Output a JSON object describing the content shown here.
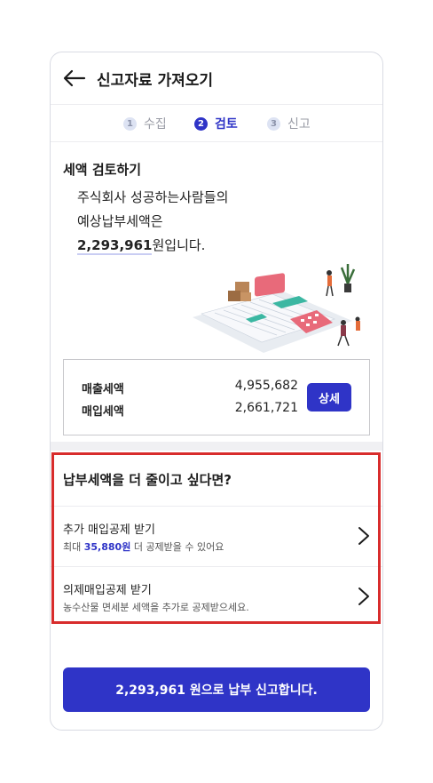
{
  "header": {
    "title": "신고자료 가져오기"
  },
  "steps": [
    {
      "num": "1",
      "label": "수집"
    },
    {
      "num": "2",
      "label": "검토"
    },
    {
      "num": "3",
      "label": "신고"
    }
  ],
  "review": {
    "section_title": "세액 검토하기",
    "line1": "주식회사 성공하는사람들의",
    "line2": "예상납부세액은",
    "amount": "2,293,961",
    "amount_suffix": "원입니다."
  },
  "totals": {
    "sales_label": "매출세액",
    "sales_value": "4,955,682",
    "purchase_label": "매입세액",
    "purchase_value": "2,661,721",
    "detail_button": "상세"
  },
  "reduce": {
    "title": "납부세액을 더 줄이고 싶다면?",
    "options": [
      {
        "title": "추가 매입공제 받기",
        "desc_prefix": "최대 ",
        "desc_amount": "35,880원",
        "desc_suffix": " 더 공제받을 수 있어요"
      },
      {
        "title": "의제매입공제 받기",
        "desc": "농수산물 면세분 세액을 추가로 공제받으세요."
      }
    ]
  },
  "cta": {
    "label": "2,293,961 원으로 납부 신고합니다."
  },
  "colors": {
    "accent": "#2f34c7",
    "highlight": "#d82c2c"
  }
}
